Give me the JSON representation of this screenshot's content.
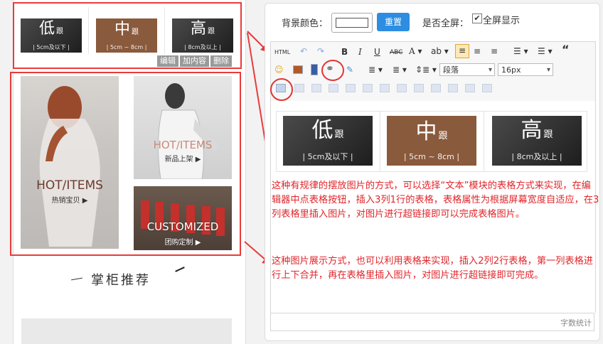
{
  "banners": [
    {
      "big": "低",
      "small": "跟",
      "sub": "| 5cm及以下 |"
    },
    {
      "big": "中",
      "small": "跟",
      "sub": "| 5cm ~ 8cm |"
    },
    {
      "big": "高",
      "small": "跟",
      "sub": "| 8cm及以上 |"
    }
  ],
  "edit_bar": {
    "edit": "编辑",
    "add_content": "加内容",
    "delete": "删除"
  },
  "photos": {
    "hot_items_left": {
      "title": "HOT/ITEMS",
      "sub": "热销宝贝 ▶"
    },
    "hot_items_right": {
      "title": "HOT/ITEMS",
      "sub": "新品上架 ▶"
    },
    "customized": {
      "title": "CUSTOMIZED",
      "sub": "团购定制 ▶"
    }
  },
  "section_title": "掌柜推荐",
  "editor": {
    "bg_color_label": "背景颜色：",
    "reset_label": "重置",
    "fullscreen_label": "是否全屏：",
    "fullscreen_option": "全屏显示",
    "fullscreen_checked": true,
    "paragraph_value": "段落",
    "font_size_value": "16px",
    "word_count_label": "字数统计",
    "explain_1": "这种有规律的摆放图片的方式，可以选择“文本”模块的表格方式来实现，在编辑器中点表格按钮，插入3列1行的表格，表格属性为根据屏幕宽度自适应，在3列表格里插入图片，对图片进行超链接即可以完成表格图片。",
    "explain_2": "这种图片展示方式，也可以利用表格来实现，插入2列2行表格，第一列表格进行上下合并，再在表格里插入图片，对图片进行超链接即可完成。"
  },
  "toolbar_icons": [
    "html-source-icon",
    "undo-icon",
    "redo-icon",
    "bold-icon",
    "italic-icon",
    "underline-icon",
    "strikethrough-icon",
    "font-color-icon",
    "highlight-icon",
    "align-left-icon",
    "align-center-icon",
    "align-right-icon",
    "unordered-list-icon",
    "ordered-list-icon",
    "blockquote-icon",
    "emoticon-icon",
    "image-icon",
    "video-icon",
    "link-icon",
    "eraser-icon",
    "line-height-icon",
    "paragraph-spacing-icon",
    "indent-icon",
    "insert-table-icon"
  ],
  "colors": {
    "accent_red": "#e93b3b",
    "reset_blue": "#2d8de0",
    "brown_banner": "#8a5a3c",
    "dark_banner": "#2c2c2c"
  }
}
